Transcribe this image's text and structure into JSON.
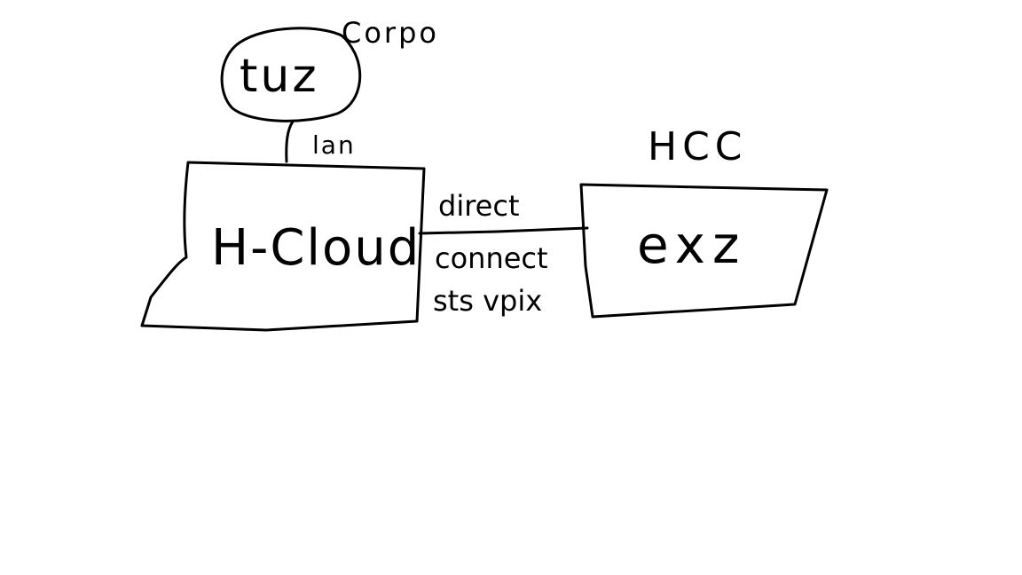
{
  "canvas": {
    "background": "#ffffff",
    "ink": "#000000"
  },
  "nodes": {
    "corp_cloud": {
      "label": "tuz",
      "annotation": "Corpo"
    },
    "h_cloud": {
      "label": "H-Cloud"
    },
    "exz": {
      "label": "exz",
      "annotation": "HCC"
    }
  },
  "links": {
    "lan_link": {
      "label": "lan"
    },
    "direct_link": {
      "label_lines": [
        "direct",
        "connect",
        "sts vpix"
      ]
    }
  }
}
